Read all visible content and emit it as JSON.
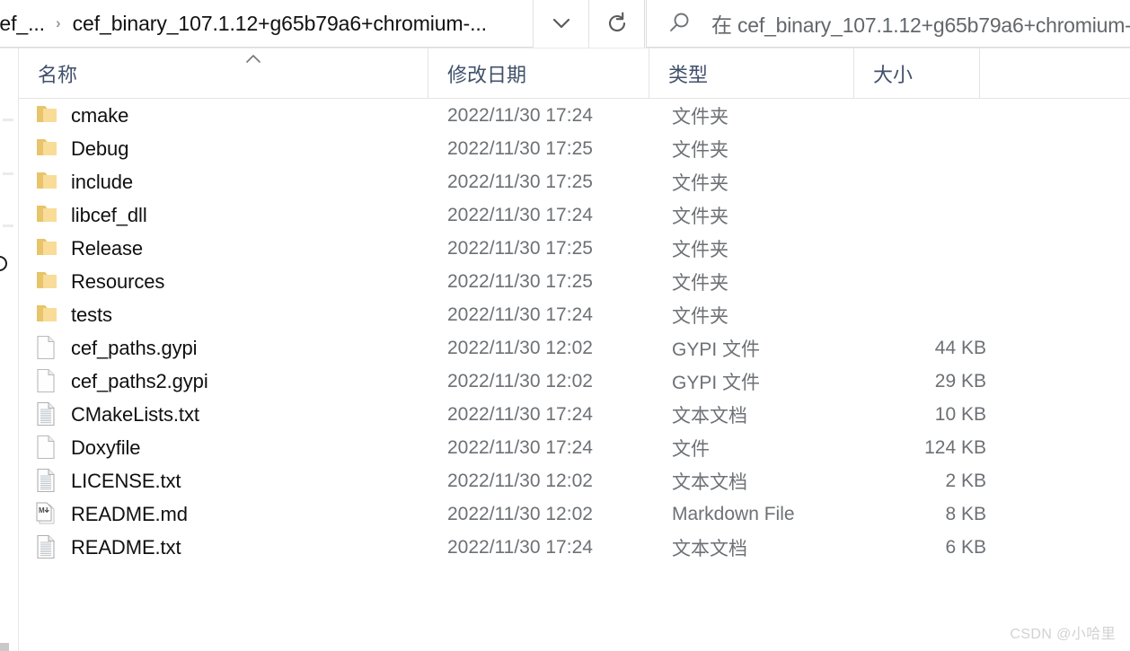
{
  "addressbar": {
    "crumb_truncated": "cef_...",
    "separator": "›",
    "crumb_current": "cef_binary_107.1.12+g65b79a6+chromium-...",
    "history_dropdown_icon": "chevron-down-icon",
    "refresh_icon": "refresh-icon"
  },
  "search": {
    "icon": "search-icon",
    "value": "在 cef_binary_107.1.12+g65b79a6+chromium-"
  },
  "columns": {
    "name": "名称",
    "date": "修改日期",
    "type": "类型",
    "size": "大小",
    "sort_indicator": "sort-ascending-caret"
  },
  "rows": [
    {
      "icon": "folder-icon",
      "name": "cmake",
      "date": "2022/11/30 17:24",
      "type": "文件夹",
      "size": ""
    },
    {
      "icon": "folder-icon",
      "name": "Debug",
      "date": "2022/11/30 17:25",
      "type": "文件夹",
      "size": ""
    },
    {
      "icon": "folder-icon",
      "name": "include",
      "date": "2022/11/30 17:25",
      "type": "文件夹",
      "size": ""
    },
    {
      "icon": "folder-icon",
      "name": "libcef_dll",
      "date": "2022/11/30 17:24",
      "type": "文件夹",
      "size": ""
    },
    {
      "icon": "folder-icon",
      "name": "Release",
      "date": "2022/11/30 17:25",
      "type": "文件夹",
      "size": ""
    },
    {
      "icon": "folder-icon",
      "name": "Resources",
      "date": "2022/11/30 17:25",
      "type": "文件夹",
      "size": ""
    },
    {
      "icon": "folder-icon",
      "name": "tests",
      "date": "2022/11/30 17:24",
      "type": "文件夹",
      "size": ""
    },
    {
      "icon": "blank-file-icon",
      "name": "cef_paths.gypi",
      "date": "2022/11/30 12:02",
      "type": "GYPI 文件",
      "size": "44 KB"
    },
    {
      "icon": "blank-file-icon",
      "name": "cef_paths2.gypi",
      "date": "2022/11/30 12:02",
      "type": "GYPI 文件",
      "size": "29 KB"
    },
    {
      "icon": "text-file-icon",
      "name": "CMakeLists.txt",
      "date": "2022/11/30 17:24",
      "type": "文本文档",
      "size": "10 KB"
    },
    {
      "icon": "blank-file-icon",
      "name": "Doxyfile",
      "date": "2022/11/30 17:24",
      "type": "文件",
      "size": "124 KB"
    },
    {
      "icon": "text-file-icon",
      "name": "LICENSE.txt",
      "date": "2022/11/30 12:02",
      "type": "文本文档",
      "size": "2 KB"
    },
    {
      "icon": "markdown-file-icon",
      "name": "README.md",
      "date": "2022/11/30 12:02",
      "type": "Markdown File",
      "size": "8 KB"
    },
    {
      "icon": "text-file-icon",
      "name": "README.txt",
      "date": "2022/11/30 17:24",
      "type": "文本文档",
      "size": "6 KB"
    }
  ],
  "watermark": "CSDN @小哈里",
  "colors": {
    "folder": "#f5d88a",
    "header_text": "#41506b",
    "row_text": "#101010",
    "meta_text": "#6d7175",
    "watermark": "#d2d2d2"
  }
}
